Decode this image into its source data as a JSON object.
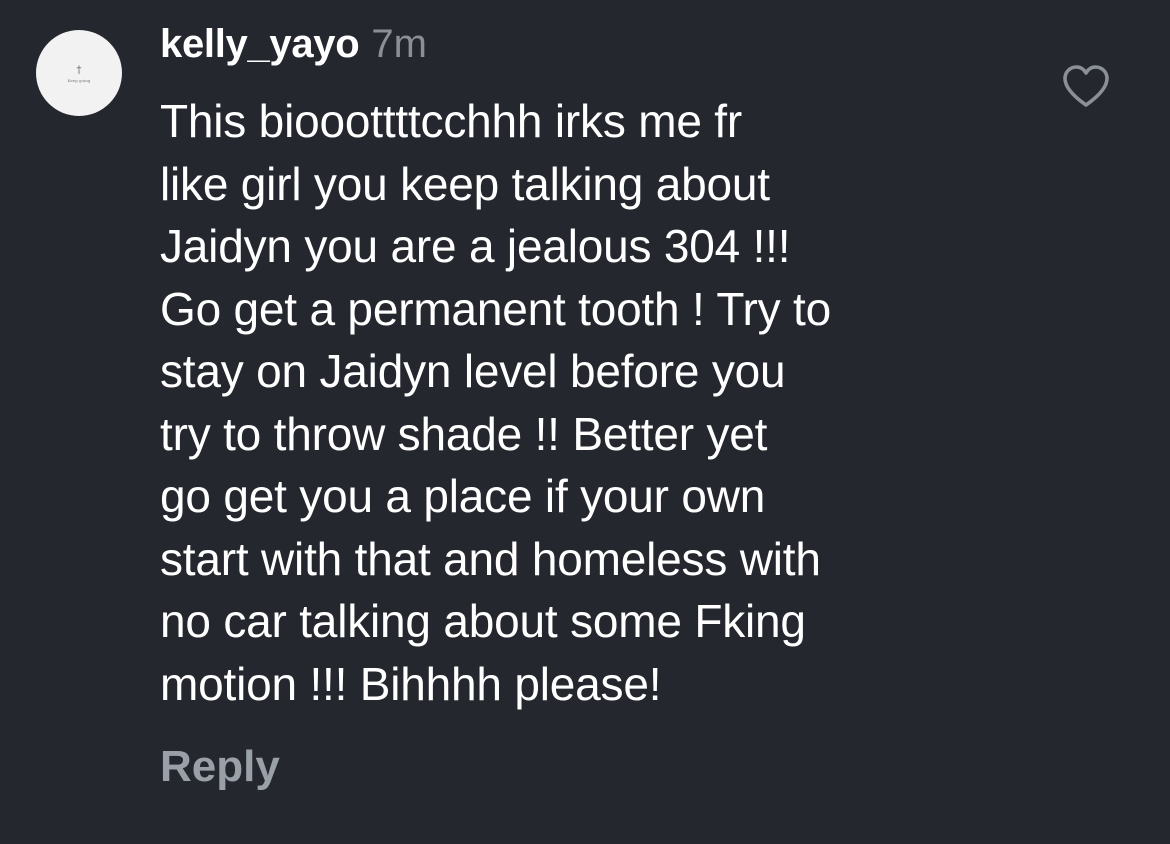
{
  "comment": {
    "avatar": {
      "symbol": "†",
      "caption": "Keep going"
    },
    "username": "kelly_yayo",
    "timestamp": "7m",
    "lines": [
      "This biooottttcchhh irks me fr",
      "like girl you keep talking about",
      "Jaidyn you are a jealous 304 !!!",
      "Go get a permanent tooth ! Try to",
      "stay on Jaidyn level before you",
      "try to throw shade !! Better yet",
      "go get you a place if your own",
      "start with that and homeless with",
      "no car talking about some Fking",
      "motion !!! Bihhhh please!"
    ],
    "reply_label": "Reply",
    "like_icon": "heart-outline-icon"
  },
  "colors": {
    "background": "#24272e",
    "text": "#ffffff",
    "muted": "#8b8f97",
    "reply": "#9aa0a8"
  }
}
